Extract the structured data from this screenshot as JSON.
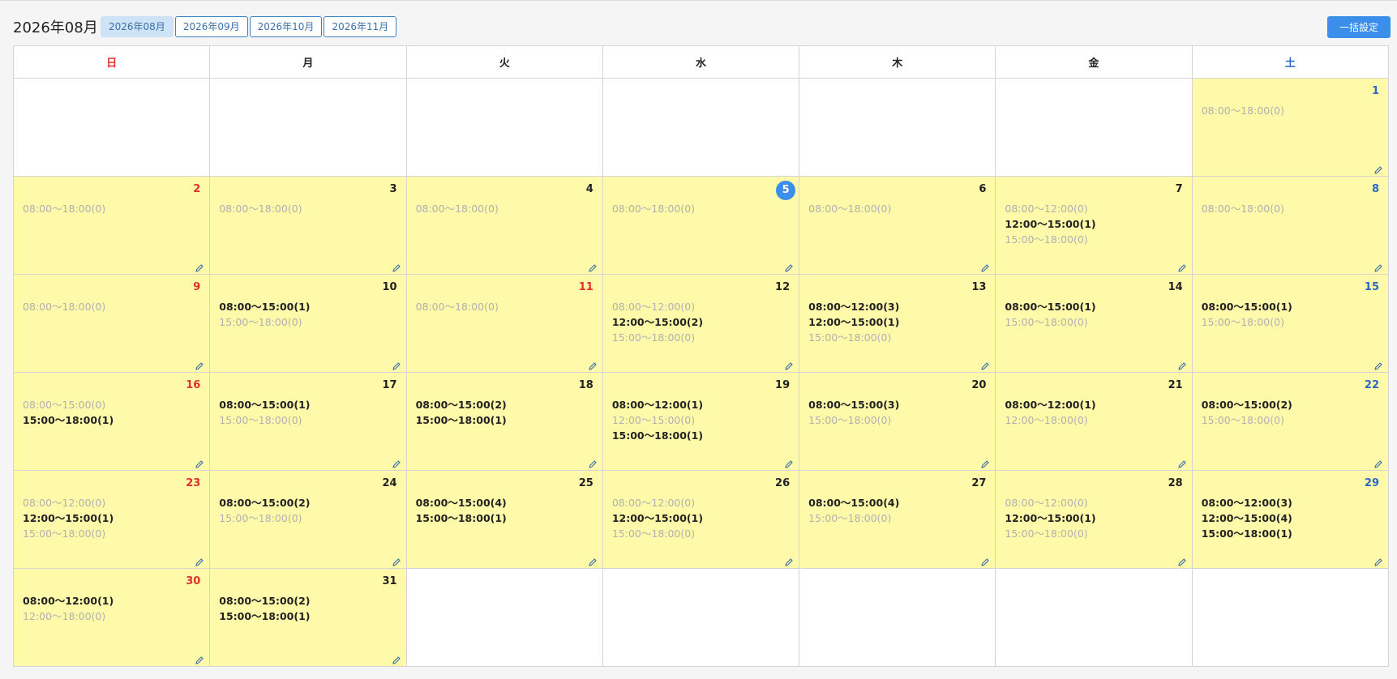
{
  "header": {
    "title": "2026年08月",
    "tabs": [
      "2026年08月",
      "2026年09月",
      "2026年10月",
      "2026年11月"
    ],
    "bulk_label": "一括設定"
  },
  "weekdays": [
    "日",
    "月",
    "火",
    "水",
    "木",
    "金",
    "土"
  ],
  "colors": {
    "sunday": "#e03030",
    "saturday": "#2d66c4",
    "active_day": "#fffaaa",
    "today": "#3b8eea",
    "accent": "#3b8eea"
  },
  "icons": {
    "edit": "pencil-icon"
  },
  "today": 5,
  "weeks": [
    [
      null,
      null,
      null,
      null,
      null,
      null,
      {
        "day": 1,
        "slots": [
          "08:00〜18:00(0)"
        ]
      }
    ],
    [
      {
        "day": 2,
        "slots": [
          "08:00〜18:00(0)"
        ]
      },
      {
        "day": 3,
        "slots": [
          "08:00〜18:00(0)"
        ]
      },
      {
        "day": 4,
        "slots": [
          "08:00〜18:00(0)"
        ]
      },
      {
        "day": 5,
        "slots": [
          "08:00〜18:00(0)"
        ]
      },
      {
        "day": 6,
        "slots": [
          "08:00〜18:00(0)"
        ]
      },
      {
        "day": 7,
        "slots": [
          "08:00〜12:00(0)",
          "12:00〜15:00(1)",
          "15:00〜18:00(0)"
        ]
      },
      {
        "day": 8,
        "slots": [
          "08:00〜18:00(0)"
        ]
      }
    ],
    [
      {
        "day": 9,
        "slots": [
          "08:00〜18:00(0)"
        ]
      },
      {
        "day": 10,
        "slots": [
          "08:00〜15:00(1)",
          "15:00〜18:00(0)"
        ]
      },
      {
        "day": 11,
        "holiday": true,
        "slots": [
          "08:00〜18:00(0)"
        ]
      },
      {
        "day": 12,
        "slots": [
          "08:00〜12:00(0)",
          "12:00〜15:00(2)",
          "15:00〜18:00(0)"
        ]
      },
      {
        "day": 13,
        "slots": [
          "08:00〜12:00(3)",
          "12:00〜15:00(1)",
          "15:00〜18:00(0)"
        ]
      },
      {
        "day": 14,
        "slots": [
          "08:00〜15:00(1)",
          "15:00〜18:00(0)"
        ]
      },
      {
        "day": 15,
        "slots": [
          "08:00〜15:00(1)",
          "15:00〜18:00(0)"
        ]
      }
    ],
    [
      {
        "day": 16,
        "slots": [
          "08:00〜15:00(0)",
          "15:00〜18:00(1)"
        ]
      },
      {
        "day": 17,
        "slots": [
          "08:00〜15:00(1)",
          "15:00〜18:00(0)"
        ]
      },
      {
        "day": 18,
        "slots": [
          "08:00〜15:00(2)",
          "15:00〜18:00(1)"
        ]
      },
      {
        "day": 19,
        "slots": [
          "08:00〜12:00(1)",
          "12:00〜15:00(0)",
          "15:00〜18:00(1)"
        ]
      },
      {
        "day": 20,
        "slots": [
          "08:00〜15:00(3)",
          "15:00〜18:00(0)"
        ]
      },
      {
        "day": 21,
        "slots": [
          "08:00〜12:00(1)",
          "12:00〜18:00(0)"
        ]
      },
      {
        "day": 22,
        "slots": [
          "08:00〜15:00(2)",
          "15:00〜18:00(0)"
        ]
      }
    ],
    [
      {
        "day": 23,
        "slots": [
          "08:00〜12:00(0)",
          "12:00〜15:00(1)",
          "15:00〜18:00(0)"
        ]
      },
      {
        "day": 24,
        "slots": [
          "08:00〜15:00(2)",
          "15:00〜18:00(0)"
        ]
      },
      {
        "day": 25,
        "slots": [
          "08:00〜15:00(4)",
          "15:00〜18:00(1)"
        ]
      },
      {
        "day": 26,
        "slots": [
          "08:00〜12:00(0)",
          "12:00〜15:00(1)",
          "15:00〜18:00(0)"
        ]
      },
      {
        "day": 27,
        "slots": [
          "08:00〜15:00(4)",
          "15:00〜18:00(0)"
        ]
      },
      {
        "day": 28,
        "slots": [
          "08:00〜12:00(0)",
          "12:00〜15:00(1)",
          "15:00〜18:00(0)"
        ]
      },
      {
        "day": 29,
        "slots": [
          "08:00〜12:00(3)",
          "12:00〜15:00(4)",
          "15:00〜18:00(1)"
        ]
      }
    ],
    [
      {
        "day": 30,
        "slots": [
          "08:00〜12:00(1)",
          "12:00〜18:00(0)"
        ]
      },
      {
        "day": 31,
        "slots": [
          "08:00〜15:00(2)",
          "15:00〜18:00(1)"
        ]
      },
      null,
      null,
      null,
      null,
      null
    ]
  ]
}
